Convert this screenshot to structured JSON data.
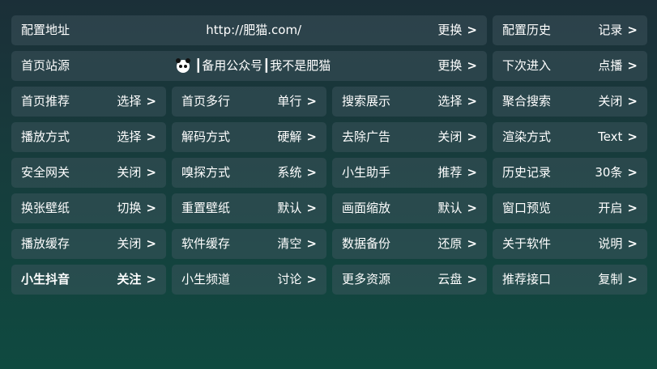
{
  "rows": [
    {
      "wide": {
        "label": "配置地址",
        "center": "http://肥猫.com/",
        "value": "更换"
      },
      "tiles": [
        {
          "label": "配置历史",
          "value": "记录"
        }
      ]
    },
    {
      "wide": {
        "label": "首页站源",
        "center": "┃备用公众号┃我不是肥猫",
        "value": "更换",
        "icon": "panda-icon"
      },
      "tiles": [
        {
          "label": "下次进入",
          "value": "点播"
        }
      ]
    },
    {
      "tiles": [
        {
          "label": "首页推荐",
          "value": "选择"
        },
        {
          "label": "首页多行",
          "value": "单行"
        },
        {
          "label": "搜索展示",
          "value": "选择"
        },
        {
          "label": "聚合搜索",
          "value": "关闭"
        }
      ]
    },
    {
      "tiles": [
        {
          "label": "播放方式",
          "value": "选择"
        },
        {
          "label": "解码方式",
          "value": "硬解"
        },
        {
          "label": "去除广告",
          "value": "关闭"
        },
        {
          "label": "渲染方式",
          "value": "Text"
        }
      ]
    },
    {
      "tiles": [
        {
          "label": "安全网关",
          "value": "关闭"
        },
        {
          "label": "嗅探方式",
          "value": "系统"
        },
        {
          "label": "小生助手",
          "value": "推荐"
        },
        {
          "label": "历史记录",
          "value": "30条"
        }
      ]
    },
    {
      "tiles": [
        {
          "label": "换张壁纸",
          "value": "切换"
        },
        {
          "label": "重置壁纸",
          "value": "默认"
        },
        {
          "label": "画面缩放",
          "value": "默认"
        },
        {
          "label": "窗口预览",
          "value": "开启"
        }
      ]
    },
    {
      "tiles": [
        {
          "label": "播放缓存",
          "value": "关闭"
        },
        {
          "label": "软件缓存",
          "value": "清空"
        },
        {
          "label": "数据备份",
          "value": "还原"
        },
        {
          "label": "关于软件",
          "value": "说明"
        }
      ]
    },
    {
      "tiles": [
        {
          "label": "小生抖音",
          "value": "关注",
          "bold": true
        },
        {
          "label": "小生频道",
          "value": "讨论"
        },
        {
          "label": "更多资源",
          "value": "云盘"
        },
        {
          "label": "推荐接口",
          "value": "复制"
        }
      ]
    }
  ],
  "chevron": ">"
}
